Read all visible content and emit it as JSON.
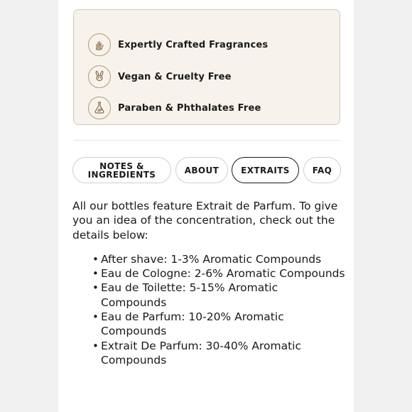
{
  "features": [
    {
      "icon": "hand-drop-icon",
      "label": "Expertly Crafted Fragrances"
    },
    {
      "icon": "rabbit-icon",
      "label": "Vegan & Cruelty Free"
    },
    {
      "icon": "flask-leaf-icon",
      "label": "Paraben & Phthalates Free"
    }
  ],
  "tabs": [
    {
      "label": "NOTES &\nINGREDIENTS",
      "active": false
    },
    {
      "label": "ABOUT",
      "active": false
    },
    {
      "label": "EXTRAITS",
      "active": true
    },
    {
      "label": "FAQ",
      "active": false
    }
  ],
  "content": {
    "intro": "All our bottles feature Extrait de Parfum. To give you an idea of the concentration, check out the details below:",
    "items": [
      "After shave: 1-3% Aromatic Compounds",
      "Eau de Cologne: 2-6% Aromatic Compounds",
      "Eau de Toilette: 5-15% Aromatic Compounds",
      "Eau de Parfum: 10-20% Aromatic Compounds",
      "Extrait De Parfum: 30-40% Aromatic Compounds"
    ]
  },
  "colors": {
    "feature_bg": "#f7f3ec",
    "icon_accent": "#b59a74",
    "text": "#1a1a1a"
  }
}
